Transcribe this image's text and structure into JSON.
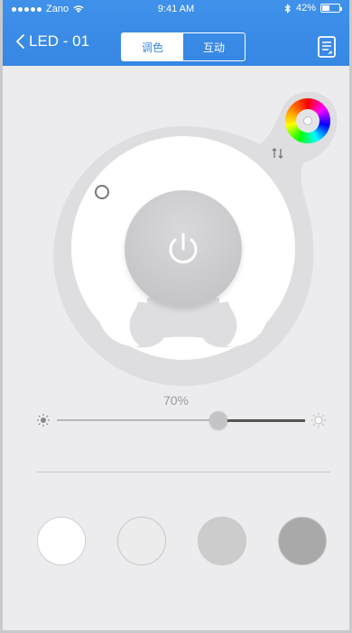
{
  "status_bar": {
    "carrier": "Zano",
    "time": "9:41 AM",
    "battery": "42%",
    "battery_level": 0.42
  },
  "header": {
    "back_label": "LED - 01",
    "tabs": [
      {
        "label": "调色",
        "active": true
      },
      {
        "label": "互动",
        "active": false
      }
    ],
    "accent_color": "#3a8ae4"
  },
  "brightness": {
    "value_label": "70%",
    "value": 0.7
  },
  "swatches": [
    {
      "color": "#ffffff"
    },
    {
      "color": "#ececec"
    },
    {
      "color": "#cdcccc"
    },
    {
      "color": "#a9a9a9"
    }
  ],
  "icons": {
    "back": "chevron-left-icon",
    "menu": "document-icon",
    "power": "power-icon",
    "swap": "swap-arrows-icon",
    "color_wheel": "color-wheel-icon",
    "sun_small": "sun-dim-icon",
    "sun_large": "sun-bright-icon"
  }
}
